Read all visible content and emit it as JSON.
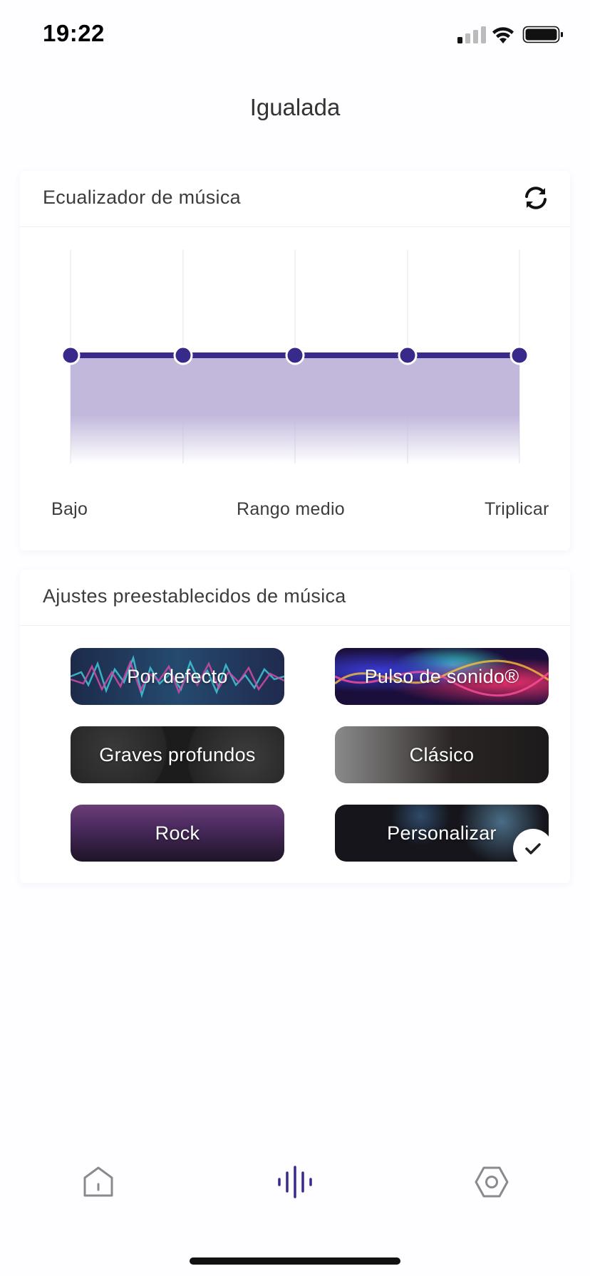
{
  "status_bar": {
    "time": "19:22"
  },
  "header": {
    "title": "Igualada"
  },
  "equalizer": {
    "section_title": "Ecualizador de música",
    "band_labels": {
      "low": "Bajo",
      "mid": "Rango medio",
      "high": "Triplicar"
    },
    "bands": [
      0,
      0,
      0,
      0,
      0
    ],
    "accent_color": "#372a8a"
  },
  "presets": {
    "section_title": "Ajustes preestablecidos de música",
    "items": [
      {
        "label": "Por defecto"
      },
      {
        "label": "Pulso de sonido®"
      },
      {
        "label": "Graves profundos"
      },
      {
        "label": "Clásico"
      },
      {
        "label": "Rock"
      },
      {
        "label": "Personalizar",
        "selected": true
      }
    ]
  },
  "bottom_nav": {
    "tabs": [
      {
        "icon": "home-icon",
        "active": false
      },
      {
        "icon": "soundwave-icon",
        "active": true
      },
      {
        "icon": "settings-hexagon-icon",
        "active": false
      }
    ]
  }
}
